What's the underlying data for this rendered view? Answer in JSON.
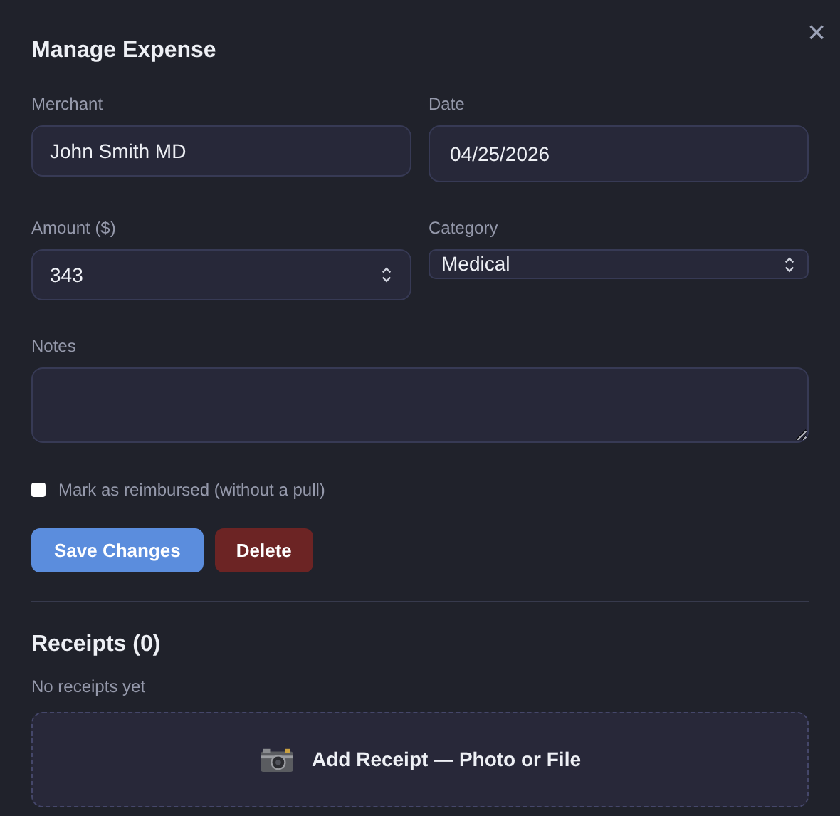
{
  "dialog": {
    "title": "Manage Expense",
    "close": "×"
  },
  "fields": {
    "merchant": {
      "label": "Merchant",
      "value": "John Smith MD"
    },
    "date": {
      "label": "Date",
      "value": "04/25/2026"
    },
    "amount": {
      "label": "Amount ($)",
      "value": "343"
    },
    "category": {
      "label": "Category",
      "value": "Medical"
    },
    "notes": {
      "label": "Notes"
    }
  },
  "reimbursed": {
    "label": "Mark as reimbursed (without a pull)",
    "checked": false
  },
  "buttons": [
    {
      "label": "Save Changes",
      "kind": "primary"
    },
    {
      "label": "Delete",
      "kind": "danger"
    }
  ],
  "receipts": {
    "title": "Receipts (0)",
    "empty": "No receipts yet",
    "add": "Add Receipt — Photo or File"
  }
}
